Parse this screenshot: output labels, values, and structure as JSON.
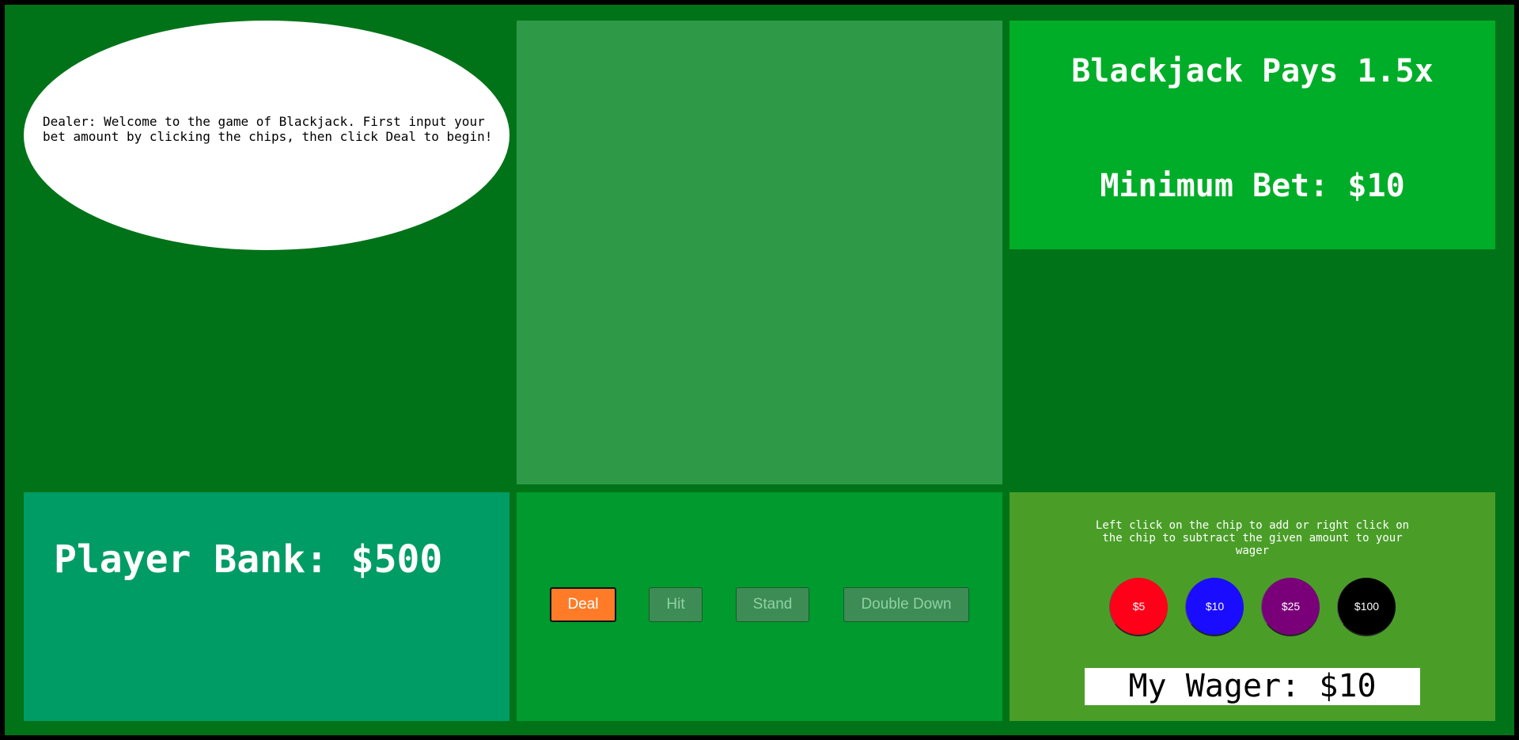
{
  "dealer": {
    "message": "Dealer: Welcome to the game of Blackjack. First input your bet amount by clicking the chips, then click Deal to begin!"
  },
  "info": {
    "payout": "Blackjack Pays 1.5x",
    "minimum_bet": "Minimum Bet: $10"
  },
  "player": {
    "bank_label": "Player Bank: $500"
  },
  "controls": {
    "deal": "Deal",
    "hit": "Hit",
    "stand": "Stand",
    "double_down": "Double Down"
  },
  "wager": {
    "instructions": "Left click on the chip to add or right click on the chip to subtract the given amount to your wager",
    "chips": [
      {
        "label": "$5",
        "color": "#ff0019"
      },
      {
        "label": "$10",
        "color": "#1a0dff"
      },
      {
        "label": "$25",
        "color": "#7a007a"
      },
      {
        "label": "$100",
        "color": "#000000"
      }
    ],
    "my_wager": "My Wager: $10"
  },
  "colors": {
    "felt": "#007318",
    "card_area": "#2e9a48",
    "info_panel": "#00ad28",
    "bank_panel": "#009c66",
    "controls_panel": "#009a2e",
    "wager_panel": "#4a9e28",
    "deal_active": "#ff7b28"
  }
}
